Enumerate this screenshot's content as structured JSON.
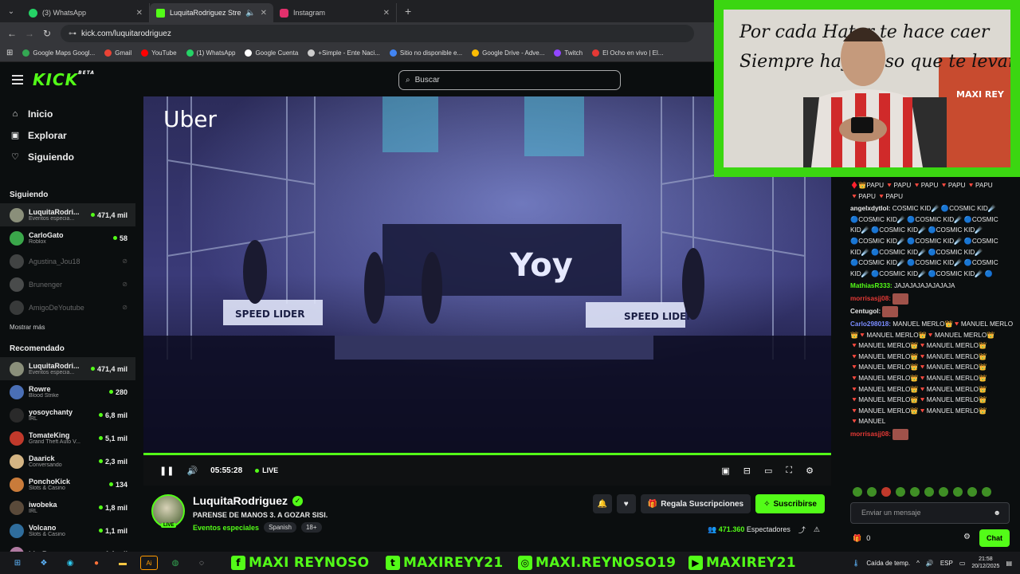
{
  "browser": {
    "tabs": [
      {
        "title": "(3) WhatsApp",
        "color": "#25d366"
      },
      {
        "title": "LuquitaRodriguez Stream -",
        "color": "#53fc18"
      },
      {
        "title": "Instagram",
        "color": "#e1306c"
      }
    ],
    "url": "kick.com/luquitarodriguez",
    "bookmarks": [
      {
        "label": "Google Maps Googl...",
        "color": "#34a853"
      },
      {
        "label": "Gmail",
        "color": "#ea4335"
      },
      {
        "label": "YouTube",
        "color": "#ff0000"
      },
      {
        "label": "(1) WhatsApp",
        "color": "#25d366"
      },
      {
        "label": "Google Cuenta",
        "color": "#ffffff"
      },
      {
        "label": "+Simple - Ente Naci...",
        "color": "#cccccc"
      },
      {
        "label": "Sitio no disponible e...",
        "color": "#4285f4"
      },
      {
        "label": "Google Drive - Adve...",
        "color": "#fbbc04"
      },
      {
        "label": "Twitch",
        "color": "#9146ff"
      },
      {
        "label": "El Ocho en vivo | El...",
        "color": "#e53935"
      }
    ]
  },
  "header": {
    "logo": "KICK",
    "logo_sup": "BETA",
    "search_placeholder": "Buscar"
  },
  "sidebar": {
    "nav": [
      {
        "label": "Inicio",
        "icon": "⌂"
      },
      {
        "label": "Explorar",
        "icon": "▣"
      },
      {
        "label": "Siguiendo",
        "icon": "♡"
      }
    ],
    "following_title": "Siguiendo",
    "following": [
      {
        "name": "LuquitaRodri...",
        "category": "Eventos especia...",
        "viewers": "471,4 mil",
        "color": "#8a8f7a",
        "selected": true
      },
      {
        "name": "CarloGato",
        "category": "Roblox",
        "viewers": "58",
        "color": "#3aa64a"
      },
      {
        "name": "Agustina_Jou18",
        "category": "",
        "viewers": "",
        "color": "#777777",
        "offline": true
      },
      {
        "name": "Brunenger",
        "category": "",
        "viewers": "",
        "color": "#888888",
        "offline": true
      },
      {
        "name": "AmigoDeYoutube",
        "category": "",
        "viewers": "",
        "color": "#666666",
        "offline": true
      }
    ],
    "show_more": "Mostrar más",
    "recommended_title": "Recomendado",
    "recommended": [
      {
        "name": "LuquitaRodri...",
        "category": "Eventos especia...",
        "viewers": "471,4 mil",
        "color": "#8a8f7a",
        "selected": true
      },
      {
        "name": "Rowre",
        "category": "Blood Strike",
        "viewers": "280",
        "color": "#4a6fb5"
      },
      {
        "name": "yosoychanty",
        "category": "IRL",
        "viewers": "6,8 mil",
        "color": "#2a2a2a"
      },
      {
        "name": "TomateKing",
        "category": "Grand Theft Auto V...",
        "viewers": "5,1 mil",
        "color": "#c0392b"
      },
      {
        "name": "Daarick",
        "category": "Conversando",
        "viewers": "2,3 mil",
        "color": "#d4b483"
      },
      {
        "name": "PonchoKick",
        "category": "Slots & Casino",
        "viewers": "134",
        "color": "#c97b3a"
      },
      {
        "name": "iwobeka",
        "category": "IRL",
        "viewers": "1,8 mil",
        "color": "#5a4a3a"
      },
      {
        "name": "Volcano",
        "category": "Slots & Casino",
        "viewers": "1,1 mil",
        "color": "#2f6d9c"
      },
      {
        "name": "LizzB",
        "category": "",
        "viewers": "1,1 mil",
        "color": "#b07aa1"
      }
    ]
  },
  "video": {
    "overlay_logo": "Uber",
    "sign_left": "SPEED LIDER",
    "sign_right": "SPEED LIDER",
    "stage_text": "Yoy",
    "time": "05:55:28",
    "live_label": "LIVE",
    "progress": 1.0
  },
  "stream": {
    "name": "LuquitaRodriguez",
    "title": "PARENSE DE MANOS 3. A GOZAR SISI.",
    "category": "Eventos especiales",
    "tags": [
      "Spanish",
      "18+"
    ],
    "live_badge": "LIVE",
    "gift_label": "Regala Suscripciones",
    "subscribe_label": "Suscribirse",
    "viewers": "471.360",
    "viewers_label": "Espectadores"
  },
  "webcam": {
    "banner_line1": "Por cada Hater  te hace caer",
    "banner_line2": "Siempre hay un so    que te levanta",
    "jersey": "MAXI REY"
  },
  "chat": {
    "messages": [
      {
        "user": "",
        "color": "#e8e8e8",
        "text": "♦️👑PAPU 🔻PAPU 🔻PAPU 🔻PAPU 🔻PAPU 🔻PAPU 🔻PAPU"
      },
      {
        "user": "angelxdytlol:",
        "color": "#e8e8e8",
        "text": "COSMIC KID☄️ 🔵COSMIC KID☄️ 🔵COSMIC KID☄️ 🔵COSMIC KID☄️ 🔵COSMIC KID☄️ 🔵COSMIC KID☄️ 🔵COSMIC KID☄️ 🔵COSMIC KID☄️ 🔵COSMIC KID☄️ 🔵COSMIC KID☄️ 🔵COSMIC KID☄️ 🔵COSMIC KID☄️ 🔵COSMIC KID☄️ 🔵COSMIC KID☄️ 🔵COSMIC KID☄️ 🔵COSMIC KID☄️ 🔵COSMIC KID☄️ 🔵"
      },
      {
        "user": "MathiasR333:",
        "color": "#53fc18",
        "text": "JAJAJAJAJAJAJAJA"
      },
      {
        "user": "morrisasjj08:",
        "color": "#e53935",
        "text": ""
      },
      {
        "user": "Centugol:",
        "color": "#e8e8e8",
        "text": ""
      },
      {
        "user": "Carlo298018:",
        "color": "#7a8cff",
        "text": "MANUEL MERLO👑🔻MANUEL MERLO👑🔻MANUEL MERLO👑🔻MANUEL MERLO👑🔻MANUEL MERLO👑🔻MANUEL MERLO👑🔻MANUEL MERLO👑🔻MANUEL MERLO👑🔻MANUEL MERLO👑🔻MANUEL MERLO👑🔻MANUEL MERLO👑🔻MANUEL MERLO👑🔻MANUEL MERLO👑🔻MANUEL MERLO👑🔻MANUEL MERLO👑🔻MANUEL MERLO👑🔻MANUEL MERLO👑🔻MANUEL MERLO👑🔻MANUEL"
      },
      {
        "user": "morrisasjj08:",
        "color": "#e53935",
        "text": ""
      }
    ],
    "input_placeholder": "Enviar un mensaje",
    "points": "0",
    "chat_button": "Chat"
  },
  "taskbar": {
    "socials": [
      {
        "icon": "f",
        "label": "MAXI REYNOSO"
      },
      {
        "icon": "t",
        "label": "MAXIREYY21"
      },
      {
        "icon": "◎",
        "label": "MAXI.REYNOSO19"
      },
      {
        "icon": "▶",
        "label": "MAXIREY21"
      }
    ],
    "weather": "Caída de temp.",
    "lang": "ESP",
    "time": "21:58",
    "date": "20/12/2025"
  },
  "colors": {
    "accent": "#53fc18",
    "bg": "#0b0e0f"
  }
}
